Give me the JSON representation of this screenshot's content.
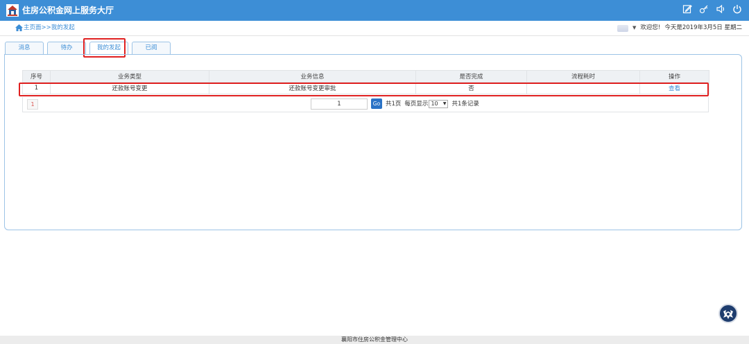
{
  "app": {
    "title": "住房公积金网上服务大厅"
  },
  "header_icons": [
    "edit-icon",
    "key-icon",
    "speaker-icon",
    "power-icon"
  ],
  "breadcrumb": {
    "home": "主页面",
    "separator": ">>",
    "current": "我的发起"
  },
  "user": {
    "greeting": "欢迎您!",
    "date_text": "今天是2019年3月5日 星期二"
  },
  "tabs": [
    {
      "label": "消息"
    },
    {
      "label": "待办"
    },
    {
      "label": "我的发起"
    },
    {
      "label": "已阅"
    }
  ],
  "table": {
    "columns": [
      "序号",
      "业务类型",
      "业务信息",
      "是否完成",
      "流程耗时",
      "操作"
    ],
    "rows": [
      {
        "index": "1",
        "type": "还款账号变更",
        "info": "还款账号变更审批",
        "done": "否",
        "duration": "",
        "action": "查看"
      }
    ]
  },
  "pager": {
    "current_page": "1",
    "page_input_value": "1",
    "go_label": "Go",
    "total_pages_text": "共1页",
    "page_size_label": "每页显示",
    "page_size_value": "10",
    "total_records_text": "共1条记录"
  },
  "footer": {
    "text": "襄阳市住房公积金管理中心"
  },
  "colors": {
    "header_bg": "#3d8ed6",
    "highlight": "#e02020",
    "link": "#3d8ed6",
    "go_button": "#2b73c6"
  }
}
